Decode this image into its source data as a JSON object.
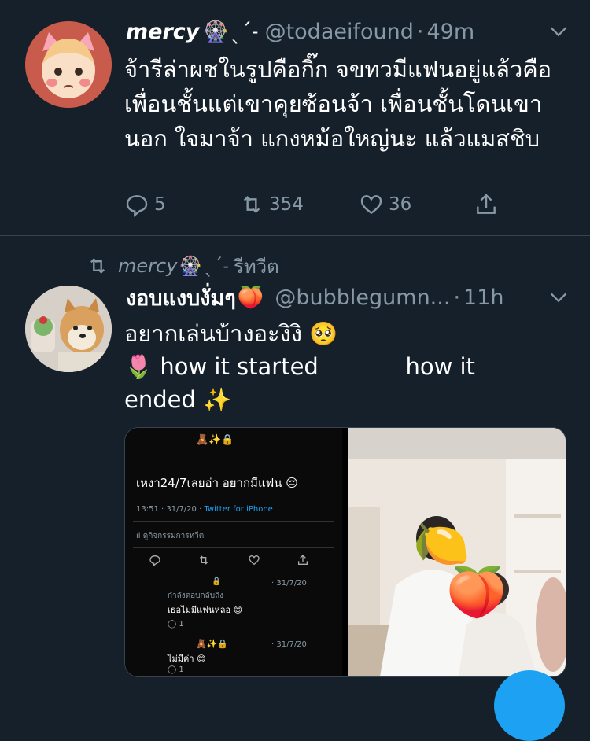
{
  "tweet1": {
    "display_name": "mercy",
    "name_emoji": "🎡",
    "name_suffix": "ˎˊ˗",
    "handle": "@todaeifound",
    "separator": "·",
    "time": "49m",
    "text": "จ้ารีล่าผชในรูปคือกิ๊ก จขทวมีแฟนอยู่แล้วคือเพื่อนชั้นแต่เขาคุยซ้อนจ้า เพื่อนชั้นโดนเขานอก ใจมาจ้า แกงหม้อใหญ่นะ แล้วแมสชิบ",
    "reply_count": "5",
    "retweet_count": "354",
    "like_count": "36"
  },
  "retweet_banner": {
    "retweeter": "mercy",
    "emoji": "🎡",
    "suffix": "ˎˊ˗",
    "label": "รีทวีต"
  },
  "tweet2": {
    "display_name": "งอบแงบงั่มๆ",
    "name_emoji": "🍑",
    "handle": "@bubblegumn...",
    "separator": "·",
    "time": "11h",
    "text_line1": "อยากเล่นบ้างอะงิงิ 🥺",
    "text_line2": "🌷 how it started            how it",
    "text_line3": "ended ✨"
  },
  "media_left": {
    "top_icons": "🧸✨🔒",
    "main_text": "เหงา24/7เลยอ่า อยากมีแฟน 😔",
    "meta_time": "13:51 · 31/7/20 · ",
    "meta_client": "Twitter for iPhone",
    "activity": "ıl ดูกิจกรรมการทวีต",
    "reply1_date": "· 31/7/20",
    "reply1_context": "กำลังตอบกลับถึง",
    "reply1_text": "เธอไม่มีแฟนหลอ 😊",
    "reply1_count": "1",
    "reply2_icons": "🧸✨🔒",
    "reply2_date": "· 31/7/20",
    "reply2_text": "ไม่มีค่า 😊",
    "reply2_count": "1"
  },
  "media_right": {
    "lemon_emoji": "🍋",
    "peach_emoji": "🍑"
  },
  "colors": {
    "background": "#15202b",
    "secondary_text": "#8899a6",
    "divider": "#38444d",
    "accent": "#1da1f2"
  }
}
